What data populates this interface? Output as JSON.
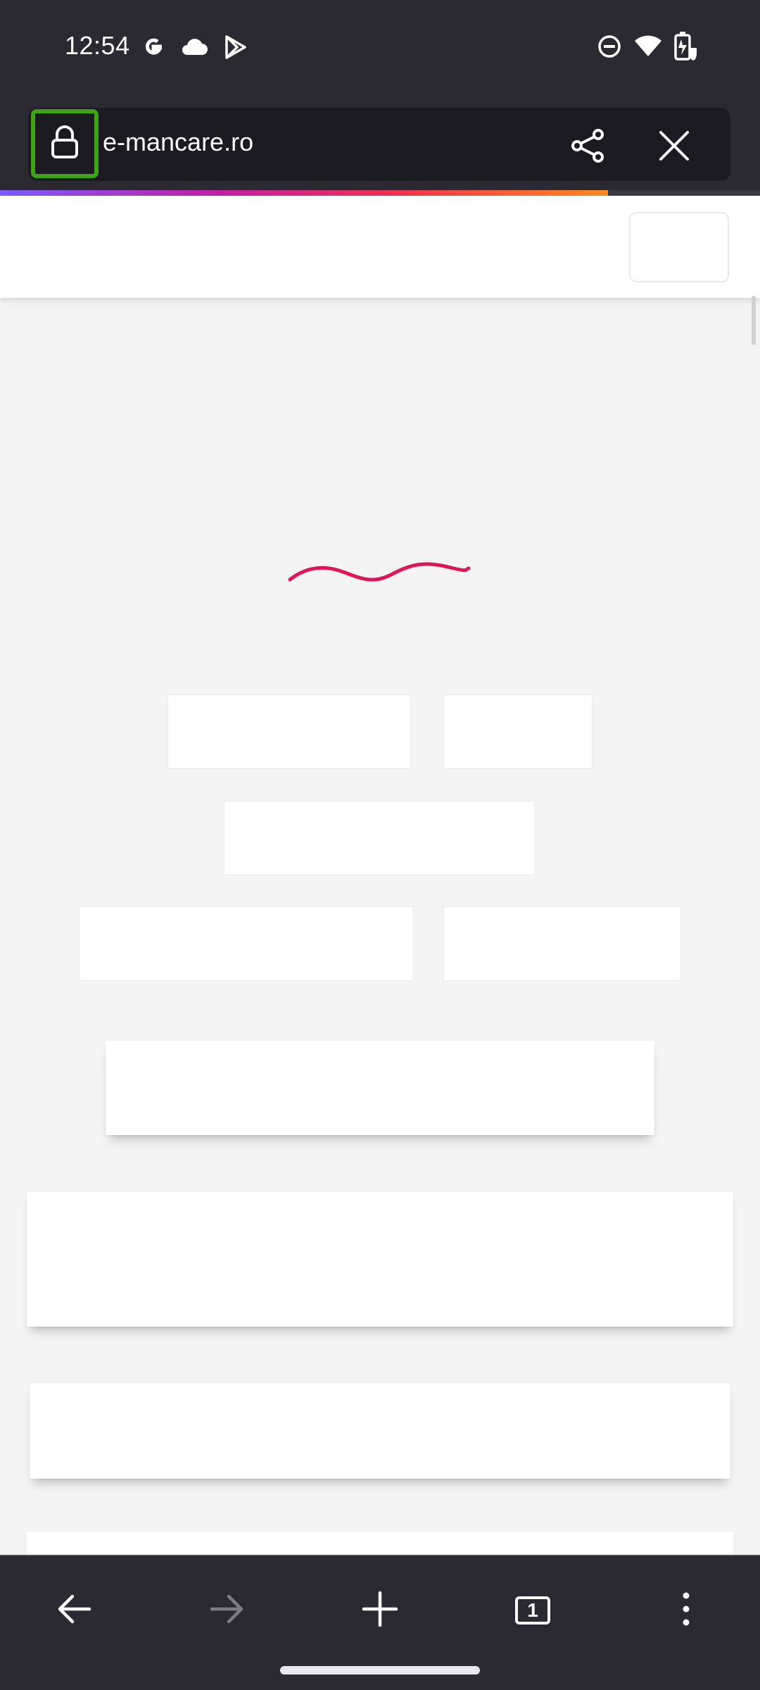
{
  "status_bar": {
    "time": "12:54",
    "left_icons": [
      "google-icon",
      "cloud-icon",
      "play-store-icon"
    ],
    "right_icons": [
      "do-not-disturb-icon",
      "wifi-icon",
      "battery-icon"
    ]
  },
  "toolbar": {
    "url": "e-mancare.ro",
    "icons": [
      "lock-icon",
      "share-icon",
      "close-icon"
    ],
    "load_progress": 0.8
  },
  "bottom_nav": {
    "tab_count": "1",
    "icons": [
      "back-arrow-icon",
      "forward-arrow-icon",
      "new-tab-plus-icon",
      "tabs-counter-icon",
      "more-menu-icon"
    ],
    "forward_enabled": false
  },
  "colors": {
    "chrome_bg": "#2b2a33",
    "url_bar_bg": "#1c1b22",
    "highlight": "#3da317",
    "spinner": "#e0145a",
    "page_bg": "#f4f4f4"
  }
}
